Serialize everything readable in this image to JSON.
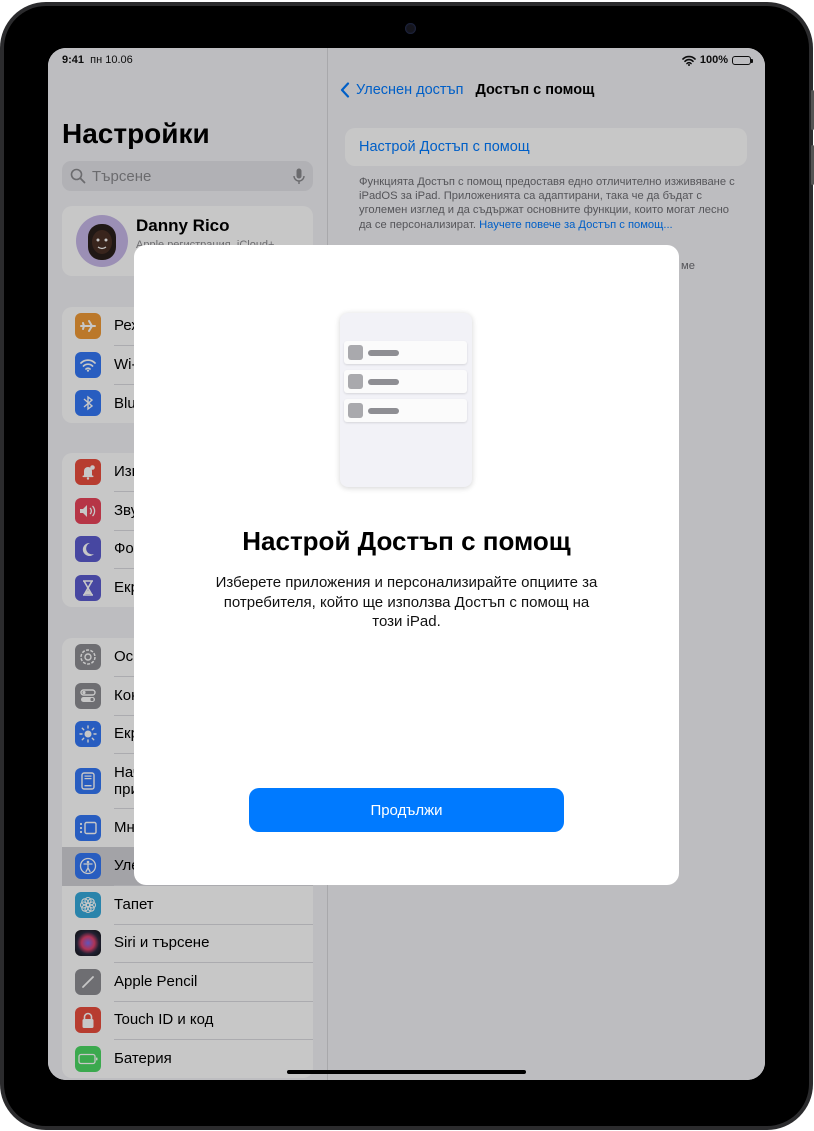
{
  "status_bar": {
    "time": "9:41",
    "date": "пн 10.06",
    "battery_percent": "100%",
    "battery_level": 1.0
  },
  "sidebar": {
    "title": "Настройки",
    "search": {
      "placeholder": "Търсене",
      "value": ""
    },
    "profile": {
      "name": "Danny Rico",
      "subtitle": "Apple регистрация, iCloud+..."
    },
    "groups": [
      [
        {
          "label": "Режим Самолет",
          "icon": "airplane-icon",
          "color": "#f09a37"
        },
        {
          "label": "Wi-Fi",
          "icon": "wifi-icon",
          "color": "#3478f6"
        },
        {
          "label": "Bluetooth",
          "icon": "bluetooth-icon",
          "color": "#3478f6"
        }
      ],
      [
        {
          "label": "Известия",
          "icon": "notifications-icon",
          "color": "#eb4d3d"
        },
        {
          "label": "Звуци",
          "icon": "sound-icon",
          "color": "#e9445a"
        },
        {
          "label": "Фокусиране",
          "icon": "moon-icon",
          "color": "#5b5ccf"
        },
        {
          "label": "Екранно време",
          "icon": "hourglass-icon",
          "color": "#5b5ccf"
        }
      ],
      [
        {
          "label": "Основни",
          "icon": "gear-icon",
          "color": "#8e8e93"
        },
        {
          "label": "Контролен център",
          "icon": "control-center-icon",
          "color": "#8e8e93"
        },
        {
          "label": "Екран и яркост",
          "icon": "brightness-icon",
          "color": "#3478f6"
        },
        {
          "label": "Начален екран с приложения",
          "icon": "home-screen-icon",
          "color": "#3478f6",
          "tall": true
        },
        {
          "label": "Многозадачност",
          "icon": "multitasking-icon",
          "color": "#3478f6"
        },
        {
          "label": "Улеснен достъп",
          "icon": "accessibility-icon",
          "color": "#3478f6",
          "selected": true
        },
        {
          "label": "Тапет",
          "icon": "wallpaper-icon",
          "color": "#36aadc"
        },
        {
          "label": "Siri и търсене",
          "icon": "siri-icon",
          "color": "#222"
        },
        {
          "label": "Apple Pencil",
          "icon": "pencil-icon",
          "color": "#8e8e93"
        },
        {
          "label": "Touch ID и код",
          "icon": "lock-icon",
          "color": "#eb4d3d"
        },
        {
          "label": "Батерия",
          "icon": "battery-icon",
          "color": "#4cd964"
        }
      ]
    ]
  },
  "detail": {
    "back_label": "Улеснен достъп",
    "title": "Достъп с помощ",
    "setup_cell": "Настрой Достъп с помощ",
    "footer_text": "Функцията Достъп с помощ предоставя едно отличително изживяване с iPadOS за iPad. Приложенията са адаптирани, така че да бъдат с уголемен изглед и да съдържат основните функции, които могат лесно да се персонализират. ",
    "footer_link": "Научете повече за Достъп с помощ...",
    "footer2_fragment": "ме"
  },
  "modal": {
    "title": "Настрой Достъп с помощ",
    "body": "Изберете приложения и персонализирайте опциите за потребителя, който ще използва Достъп с помощ на този iPad.",
    "continue_label": "Продължи"
  }
}
